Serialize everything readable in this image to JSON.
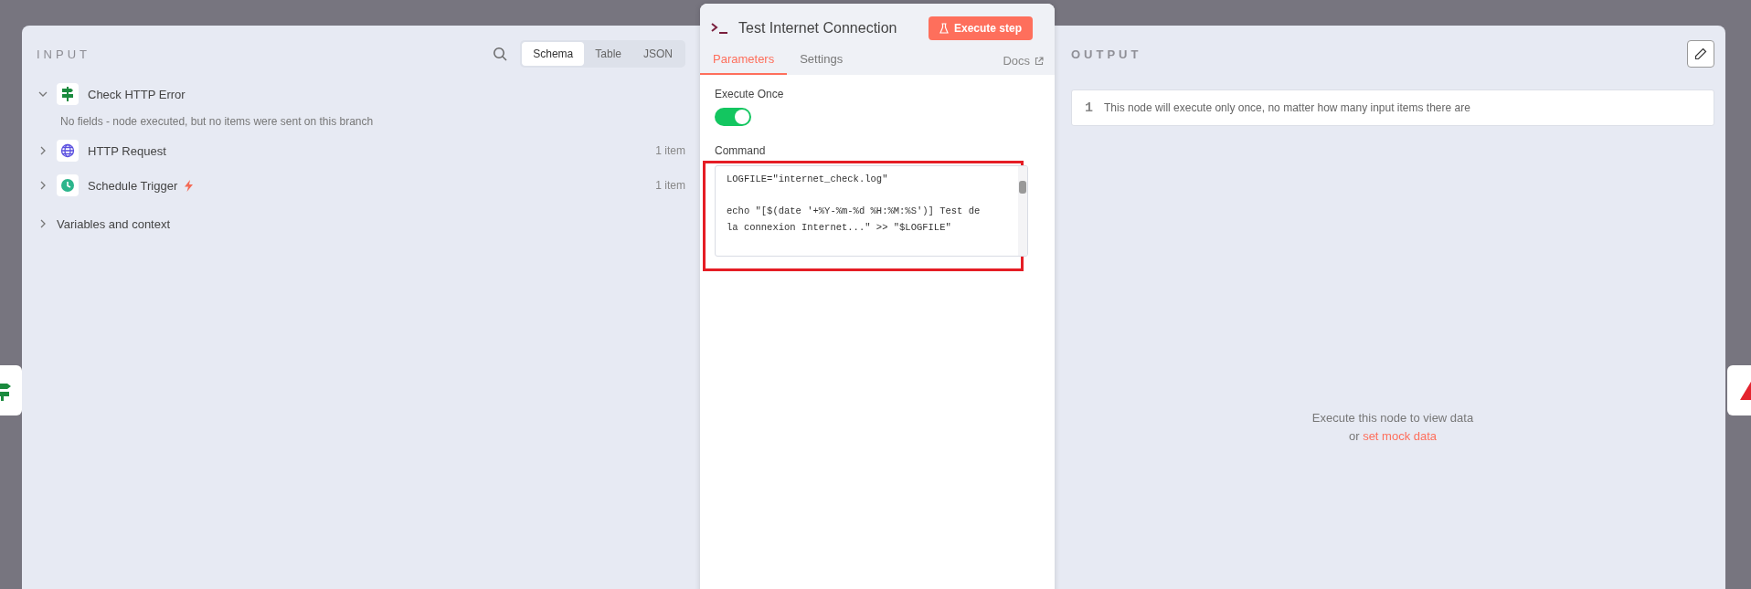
{
  "input_panel": {
    "title": "INPUT",
    "view_tabs": [
      {
        "label": "Schema",
        "selected": true
      },
      {
        "label": "Table",
        "selected": false
      },
      {
        "label": "JSON",
        "selected": false
      }
    ],
    "nodes": [
      {
        "kind": "signpost",
        "name": "Check HTTP Error",
        "expanded": true,
        "message": "No fields - node executed, but no items were sent on this branch",
        "trigger": false
      },
      {
        "kind": "globe",
        "name": "HTTP Request",
        "expanded": false,
        "count": "1 item",
        "trigger": false
      },
      {
        "kind": "clock",
        "name": "Schedule Trigger",
        "expanded": false,
        "count": "1 item",
        "trigger": true
      }
    ],
    "variables": {
      "label": "Variables and context",
      "expanded": false
    }
  },
  "node_panel": {
    "title": "Test Internet Connection",
    "execute_button": "Execute step",
    "tabs": [
      {
        "label": "Parameters",
        "selected": true
      },
      {
        "label": "Settings",
        "selected": false
      }
    ],
    "docs_link": "Docs",
    "execute_once": {
      "label": "Execute Once",
      "on": true
    },
    "command": {
      "label": "Command",
      "lines": [
        "LOGFILE=\"internet_check.log\"",
        "echo \"[$(date '+%Y-%m-%d %H:%M:%S')] Test de la connexion Internet...\" >> \"$LOGFILE\""
      ]
    }
  },
  "output_panel": {
    "title": "OUTPUT",
    "notice": {
      "number": "1",
      "text": "This node will execute only once, no matter how many input items there are"
    },
    "empty_message": "Execute this node to view data",
    "mock_prefix": "or",
    "mock_link": "set mock data"
  }
}
